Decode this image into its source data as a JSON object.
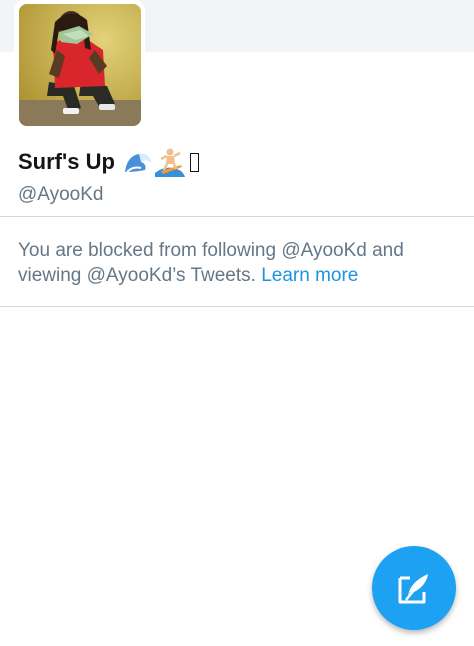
{
  "profile": {
    "display_name": "Surf's Up",
    "name_emoji": [
      "wave-emoji",
      "surfer-emoji",
      "missing-glyph"
    ],
    "handle": "@AyooKd",
    "avatar_icon": "profile-photo"
  },
  "blocked_notice": {
    "message": "You are blocked from following @AyooKd and viewing @AyooKd’s Tweets.",
    "link_label": "Learn more"
  },
  "fab": {
    "icon": "compose-tweet-icon"
  },
  "colors": {
    "accent": "#1da1f2",
    "link": "#1b95e0",
    "secondary_text": "#657786",
    "primary_text": "#14171a",
    "divider": "#cfd9de"
  }
}
